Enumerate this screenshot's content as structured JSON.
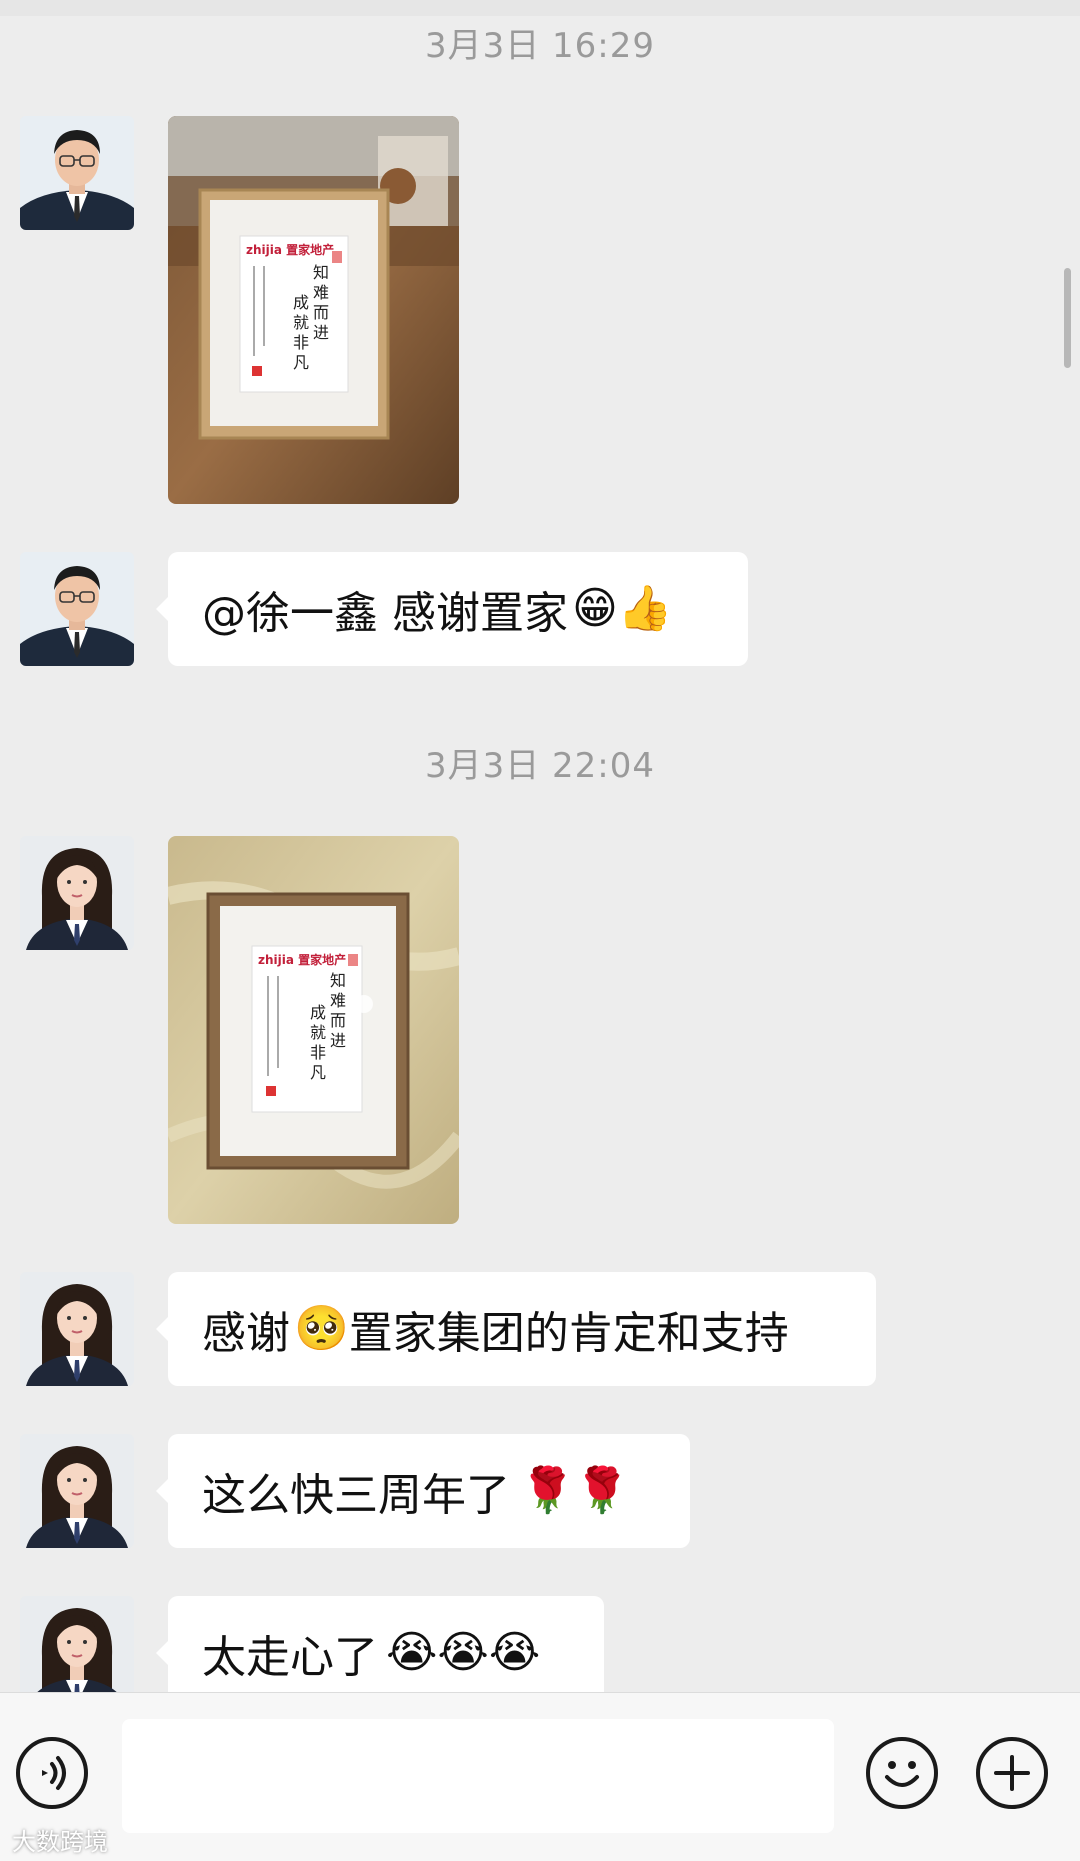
{
  "messages": {
    "timestamp_1": "3月3日 16:29",
    "msg_2": {
      "mention": "@徐一鑫",
      "text": "感谢置家",
      "emoji": "😁👍"
    },
    "timestamp_2": "3月3日 22:04",
    "msg_4": {
      "text_a": "感谢",
      "emoji": "🥺",
      "text_b": "置家集团的肯定和支持"
    },
    "msg_5": {
      "text": "这么快三周年了",
      "emoji": "🌹🌹"
    },
    "msg_6": {
      "text": "太走心了",
      "emoji": "😭😭😭"
    }
  },
  "photo": {
    "brand_text": "zhijia 置家地产",
    "calligraphy_line_1": "知难而进",
    "calligraphy_line_2": "成就非凡"
  },
  "input_bar": {
    "icons": [
      "voice-icon",
      "emoji-icon",
      "plus-icon"
    ],
    "input_value": ""
  },
  "watermark": "大数跨境",
  "colors": {
    "background": "#ededed",
    "bubble": "#ffffff",
    "timestamp": "#9a9a9a"
  }
}
